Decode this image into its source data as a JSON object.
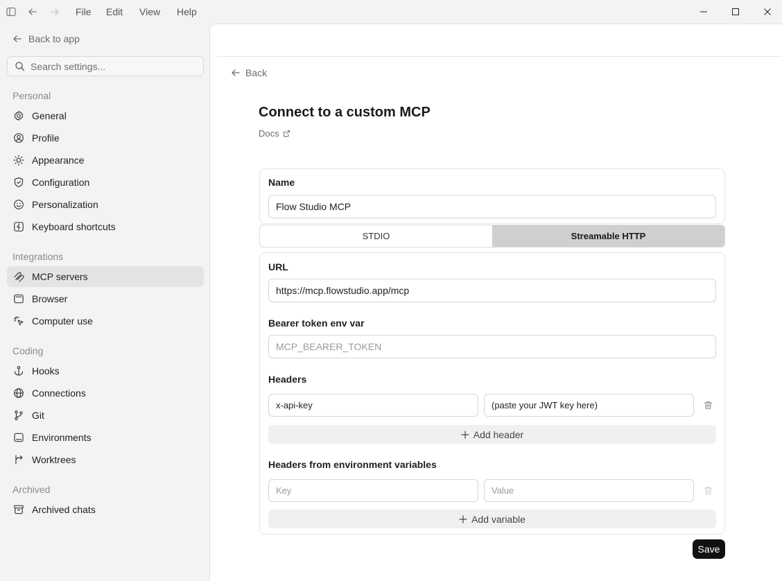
{
  "menu": {
    "file": "File",
    "edit": "Edit",
    "view": "View",
    "help": "Help"
  },
  "sidebar": {
    "back_to_app": "Back to app",
    "search_placeholder": "Search settings...",
    "sections": {
      "personal": "Personal",
      "integrations": "Integrations",
      "coding": "Coding",
      "archived": "Archived"
    },
    "items": {
      "general": "General",
      "profile": "Profile",
      "appearance": "Appearance",
      "configuration": "Configuration",
      "personalization": "Personalization",
      "keyboard_shortcuts": "Keyboard shortcuts",
      "mcp_servers": "MCP servers",
      "browser": "Browser",
      "computer_use": "Computer use",
      "hooks": "Hooks",
      "connections": "Connections",
      "git": "Git",
      "environments": "Environments",
      "worktrees": "Worktrees",
      "archived_chats": "Archived chats"
    },
    "active_item": "mcp_servers"
  },
  "main": {
    "back": "Back",
    "title": "Connect to a custom MCP",
    "docs": "Docs",
    "name": {
      "label": "Name",
      "value": "Flow Studio MCP"
    },
    "transport": {
      "stdio": "STDIO",
      "http": "Streamable HTTP",
      "selected": "Streamable HTTP"
    },
    "url": {
      "label": "URL",
      "value": "https://mcp.flowstudio.app/mcp"
    },
    "bearer": {
      "label": "Bearer token env var",
      "placeholder": "MCP_BEARER_TOKEN"
    },
    "headers": {
      "label": "Headers",
      "key_value": "x-api-key",
      "value_value": "(paste your JWT key here)",
      "add_label": "Add header"
    },
    "env_headers": {
      "label": "Headers from environment variables",
      "key_placeholder": "Key",
      "value_placeholder": "Value",
      "add_label": "Add variable"
    },
    "save": "Save"
  },
  "colors": {
    "active_nav_bg": "#e4e4e4",
    "toggle_on_bg": "#cfcfcf",
    "save_bg": "#111111"
  }
}
